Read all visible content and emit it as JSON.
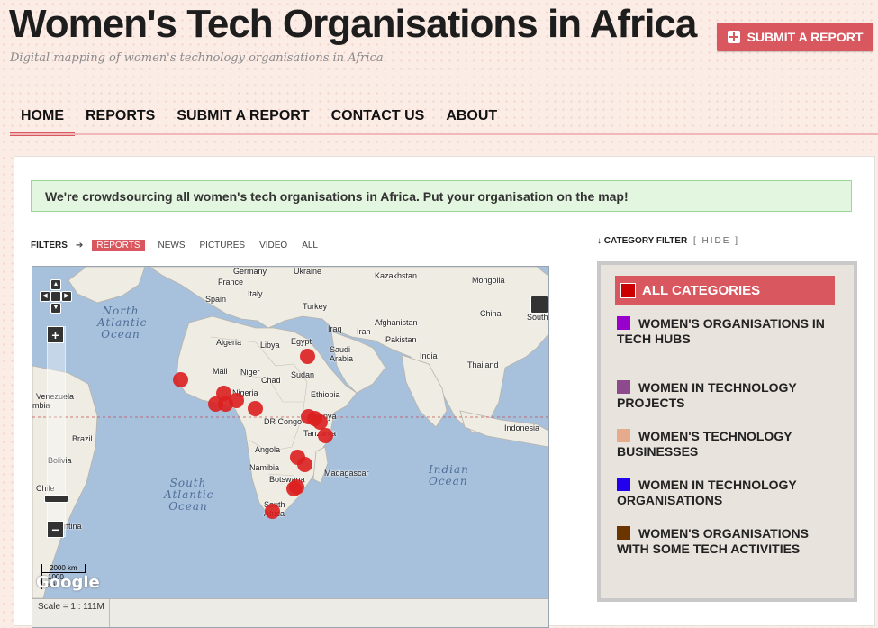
{
  "site": {
    "title": "Women's Tech Organisations in Africa",
    "tagline": "Digital mapping of women's technology organisations in Africa",
    "submit_button": "SUBMIT A REPORT"
  },
  "nav": {
    "items": [
      "HOME",
      "REPORTS",
      "SUBMIT A REPORT",
      "CONTACT US",
      "ABOUT"
    ],
    "active": "HOME"
  },
  "notice": "We're crowdsourcing all women's tech organisations in Africa. Put your organisation on the map!",
  "filters": {
    "label": "FILTERS",
    "items": [
      "REPORTS",
      "NEWS",
      "PICTURES",
      "VIDEO",
      "ALL"
    ],
    "active": "REPORTS"
  },
  "map": {
    "places": [
      "Germany",
      "Ukraine",
      "Kazakhstan",
      "France",
      "Italy",
      "Mongolia",
      "Spain",
      "Turkey",
      "China",
      "Afghanistan",
      "Iraq",
      "Iran",
      "Pakistan",
      "Algeria",
      "Libya",
      "Egypt",
      "Saudi Arabia",
      "India",
      "Thailand",
      "Mali",
      "Niger",
      "Sudan",
      "Chad",
      "Nigeria",
      "Ethiopia",
      "Venezuela",
      "DR Congo",
      "Kenya",
      "Indonesia",
      "Tanzania",
      "Brazil",
      "Angola",
      "Bolivia",
      "Namibia",
      "Madagascar",
      "Botswana",
      "Chile",
      "South Africa",
      "Argentina",
      "South",
      "mbia"
    ],
    "oceans": [
      "North Atlantic Ocean",
      "South Atlantic Ocean",
      "Indian Ocean"
    ],
    "scale_km": "2000 km",
    "scale_mi": "1000 mi",
    "scale_text": "Scale = 1 : 111M",
    "attribution": "Google",
    "zoom_in": "+",
    "zoom_out": "−",
    "report_count": 16
  },
  "category_filter": {
    "title": "CATEGORY FILTER",
    "hide_label": "[ HIDE ]",
    "items": [
      {
        "label": "ALL CATEGORIES",
        "color": "#cc0000",
        "active": true
      },
      {
        "label": "WOMEN'S ORGANISATIONS IN TECH HUBS",
        "color": "#9900cc"
      },
      {
        "label": "WOMEN IN TECHNOLOGY PROJECTS",
        "color": "#8e4a8e"
      },
      {
        "label": "WOMEN'S TECHNOLOGY BUSINESSES",
        "color": "#e6aa8c"
      },
      {
        "label": "WOMEN IN TECHNOLOGY ORGANISATIONS",
        "color": "#2200ee"
      },
      {
        "label": "WOMEN'S ORGANISATIONS WITH SOME TECH ACTIVITIES",
        "color": "#6b3500"
      }
    ]
  },
  "colors": {
    "accent": "#d9575f",
    "notice_bg": "#e3f6df",
    "marker": "#dc1f1f",
    "water": "#a7c0dc",
    "land": "#efece4"
  }
}
